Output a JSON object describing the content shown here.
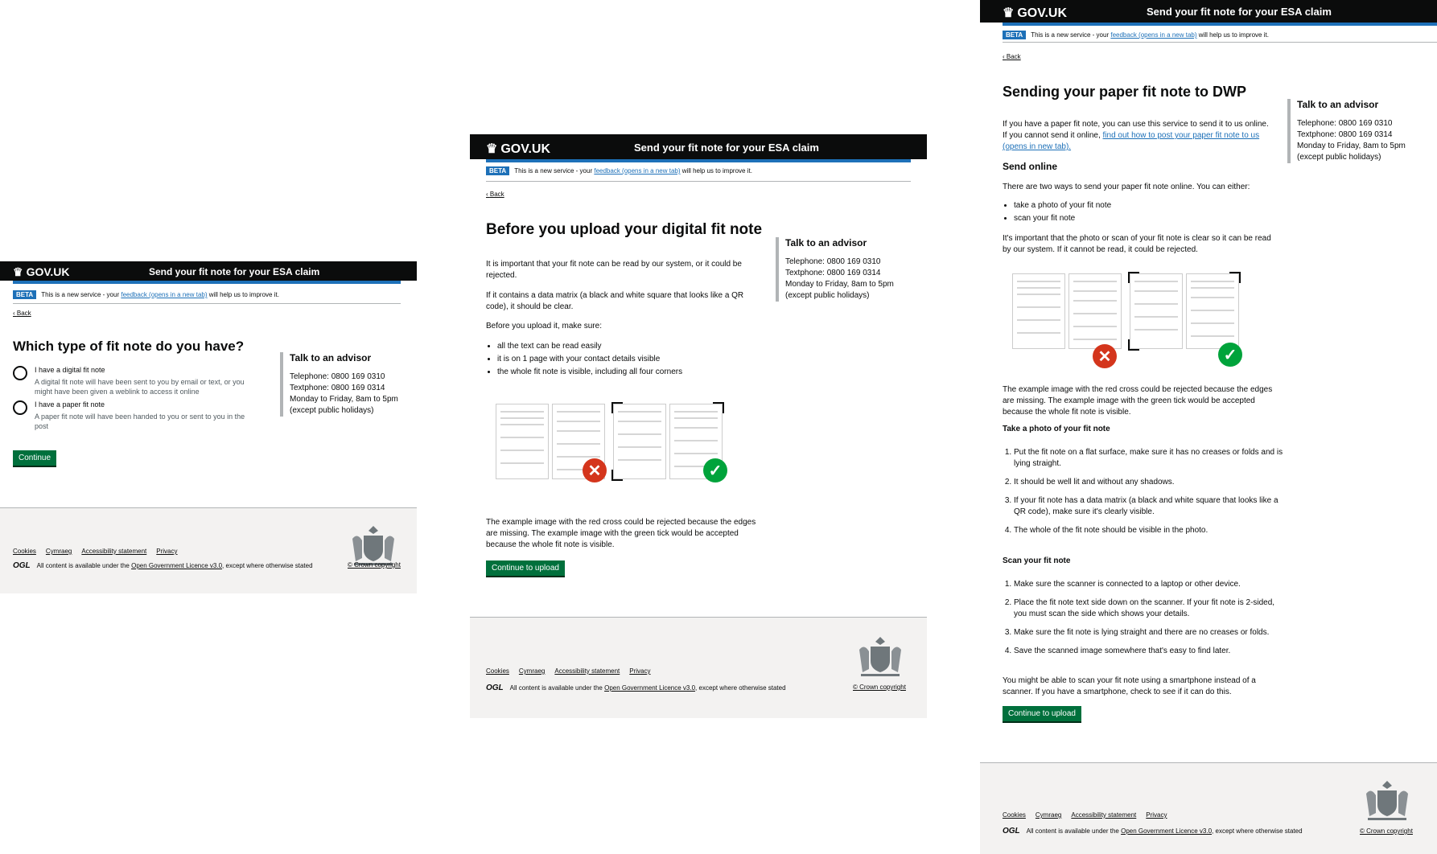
{
  "common": {
    "logo": "GOV.UK",
    "service_name": "Send your fit note for your ESA claim",
    "phase_tag": "BETA",
    "phase_text_before": "This is a new service - your ",
    "phase_link": "feedback (opens in a new tab)",
    "phase_text_after": " will help us to improve it.",
    "back": "Back",
    "continue_upload": "Continue to upload",
    "aside": {
      "title": "Talk to an advisor",
      "telephone": "Telephone: 0800 169 0310",
      "textphone": "Textphone: 0800 169 0314",
      "hours": "Monday to Friday, 8am to 5pm",
      "hours_note": "(except public holidays)"
    },
    "footer": {
      "links": [
        "Cookies",
        "Cymraeg",
        "Accessibility statement",
        "Privacy"
      ],
      "ogl_logo": "OGL",
      "licence_before": "All content is available under the ",
      "licence_link": "Open Government Licence v3.0",
      "licence_after": ", except where otherwise stated",
      "copyright": "© Crown copyright"
    },
    "colors": {
      "header": "#0b0c0c",
      "accent": "#1d70b8",
      "button": "#00703c",
      "cross": "#d4351c",
      "tick": "#00a33b"
    }
  },
  "page1": {
    "heading": "Which type of fit note do you have?",
    "options": [
      {
        "label": "I have a digital fit note",
        "hint": "A digital fit note will have been sent to you by email or text, or you might have been given a weblink to access it online"
      },
      {
        "label": "I have a paper fit note",
        "hint": "A paper fit note will have been handed to you or sent to you in the post"
      }
    ],
    "button": "Continue"
  },
  "page2": {
    "heading": "Before you upload your digital fit note",
    "p1": "It is important that your fit note can be read by our system, or it could be rejected.",
    "p2": "If it contains a data matrix (a black and white square that looks like a QR code), it should be clear.",
    "p3": "Before you upload it, make sure:",
    "bullets": [
      "all the text can be read easily",
      "it is on 1 page with your contact details visible",
      "the whole fit note is visible, including all four corners"
    ],
    "caption": "The example image with the red cross could be rejected because the edges are missing. The example image with the green tick would be accepted because the whole fit note is visible."
  },
  "page3": {
    "heading": "Sending your paper fit note to DWP",
    "intro_before": "If you have a paper fit note, you can use this service to send it to us online. If you cannot send it online, ",
    "intro_link": "find out how to post your paper fit note to us (opens in new tab).",
    "send_online": "Send online",
    "two_ways": "There are two ways to send your paper fit note online. You can either:",
    "ways": [
      "take a photo of your fit note",
      "scan your fit note"
    ],
    "important": "It's important that the photo or scan of your fit note is clear so it can be read by our system. If it cannot be read, it could be rejected.",
    "caption": "The example image with the red cross could be rejected because the edges are missing. The example image with the green tick would be accepted because the whole fit note is visible.",
    "photo_heading": "Take a photo of your fit note",
    "photo_steps": [
      "Put the fit note on a flat surface, make sure it has no creases or folds and is lying straight.",
      "It should be well lit and without any shadows.",
      "If your fit note has a data matrix (a black and white square that looks like a QR code), make sure it's clearly visible.",
      "The whole of the fit note should be visible in the photo."
    ],
    "scan_heading": "Scan your fit note",
    "scan_steps": [
      "Make sure the scanner is connected to a laptop or other device.",
      "Place the fit note text side down on the scanner. If your fit note is 2-sided, you must scan the side which shows your details.",
      "Make sure the fit note is lying straight and there are no creases or folds.",
      "Save the scanned image somewhere that's easy to find later."
    ],
    "smartphone": "You might be able to scan your fit note using a smartphone instead of a scanner. If you have a smartphone, check to see if it can do this."
  }
}
